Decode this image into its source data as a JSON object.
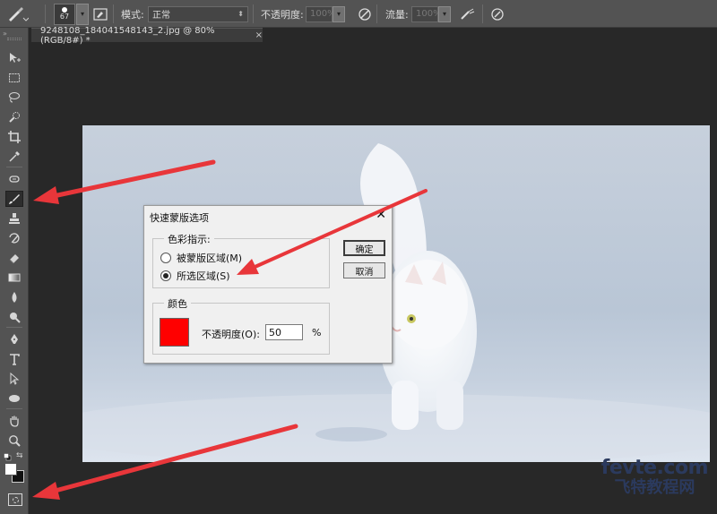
{
  "options_bar": {
    "brush_size": "67",
    "mode_label": "模式:",
    "mode_value": "正常",
    "opacity_label": "不透明度:",
    "opacity_value": "100%",
    "flow_label": "流量:",
    "flow_value": "100%"
  },
  "document_tab": {
    "title": "9248108_184041548143_2.jpg @ 80%(RGB/8#) *",
    "close": "×"
  },
  "dialog": {
    "title": "快速蒙版选项",
    "close": "✕",
    "color_indicates_group": "色彩指示:",
    "option_masked": "被蒙版区域(M)",
    "option_selected": "所选区域(S)",
    "selected_option": "所选区域(S)",
    "ok_button": "确定",
    "cancel_button": "取消",
    "color_group": "颜色",
    "swatch_color": "#ff0000",
    "opacity_label": "不透明度(O):",
    "opacity_value": "50",
    "percent": "%"
  },
  "watermark": {
    "line1": "fevte.com",
    "line2": "飞特教程网"
  },
  "colors": {
    "annotation_arrow": "#e8363a",
    "panel_bg": "#535353",
    "workspace_bg": "#282828"
  }
}
